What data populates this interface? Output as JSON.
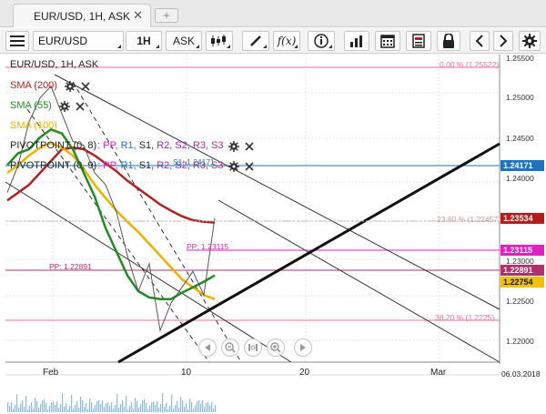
{
  "tab": {
    "title": "EUR/USD, 1H, ASK",
    "close": "✕",
    "add": "+"
  },
  "toolbar": {
    "symbol": "EUR/USD",
    "timeframe": "1H",
    "price_type": "ASK"
  },
  "legend": {
    "title": "EUR/USD, 1H, ASK",
    "sma200": {
      "label": "SMA (200)",
      "color": "#b22222"
    },
    "sma55": {
      "label": "SMA (55)",
      "color": "#228b22"
    },
    "sma100": {
      "label": "SMA (100)",
      "color": "#f0b000"
    },
    "pivot08": {
      "name": "PIVOTPOINT (0, 8)",
      "pp": ": PP,",
      "r1": "R1,",
      "s1": "S1,",
      "r2": "R2,",
      "s2": "S2,",
      "r3": "R3,",
      "s3": "S3"
    },
    "pivot09": {
      "name": "PIVOTPOINT (0, 9)",
      "pp": ": PP,",
      "r1": "R1,",
      "s1": "S1,",
      "r2": "R2,",
      "s2": "S2,",
      "r3": "R3,",
      "s3": "S3"
    }
  },
  "price_axis": {
    "ticks": [
      "1.25500",
      "1.25000",
      "1.24500",
      "1.24000",
      "1.23000",
      "1.22500",
      "1.22000"
    ],
    "badges": [
      {
        "value": "1.24171",
        "bg": "#1e73be",
        "fg": "#ffffff"
      },
      {
        "value": "1.23534",
        "bg": "#b71c1c",
        "fg": "#ffffff"
      },
      {
        "value": "1.23115",
        "bg": "#e020c0",
        "fg": "#ffffff"
      },
      {
        "value": "1.22891",
        "bg": "#b0306a",
        "fg": "#ffffff"
      },
      {
        "value": "1.22754",
        "bg": "#f2c200",
        "fg": "#111111"
      }
    ]
  },
  "chart_labels": {
    "fib_0": "0.00 % (1.25522)",
    "fib_236": "23.60 % (1.22457)",
    "fib_382": "38.20 % (1.2225)",
    "pp_1": "PP: 1.23115",
    "pp_2": "PP: 1.22891",
    "s1": "S1: 1.24171"
  },
  "time_axis": {
    "labels": [
      "Feb",
      "10",
      "20",
      "Mar"
    ],
    "date": "06.03.2018"
  },
  "chart_data": {
    "type": "line",
    "title": "EUR/USD, 1H, ASK",
    "series": [
      {
        "name": "EUR/USD",
        "values": [
          1.2385,
          1.242,
          1.2475,
          1.2505,
          1.252,
          1.2485,
          1.245,
          1.2445,
          1.241,
          1.2395,
          1.236,
          1.2305,
          1.226,
          1.2295,
          1.221,
          1.2245,
          1.2265,
          1.2285,
          1.2255,
          1.2353
        ]
      },
      {
        "name": "SMA (200)",
        "values": [
          1.2375,
          1.2385,
          1.2395,
          1.241,
          1.2425,
          1.244,
          1.2442,
          1.244,
          1.2432,
          1.2422,
          1.2412,
          1.24,
          1.239,
          1.238,
          1.237,
          1.2362,
          1.2355,
          1.235,
          1.2348,
          1.2347
        ]
      },
      {
        "name": "SMA (55)",
        "values": [
          1.242,
          1.2435,
          1.244,
          1.2455,
          1.2465,
          1.246,
          1.244,
          1.241,
          1.238,
          1.234,
          1.231,
          1.228,
          1.226,
          1.2252,
          1.225,
          1.225,
          1.2258,
          1.2265,
          1.2272,
          1.228
        ]
      },
      {
        "name": "SMA (100)",
        "values": [
          1.241,
          1.242,
          1.2432,
          1.2442,
          1.2448,
          1.2442,
          1.2432,
          1.2415,
          1.2395,
          1.2378,
          1.2362,
          1.2348,
          1.2335,
          1.232,
          1.2305,
          1.229,
          1.2275,
          1.2265,
          1.2255,
          1.225
        ]
      }
    ],
    "ylim": [
      1.217,
      1.256
    ],
    "grid": true
  }
}
